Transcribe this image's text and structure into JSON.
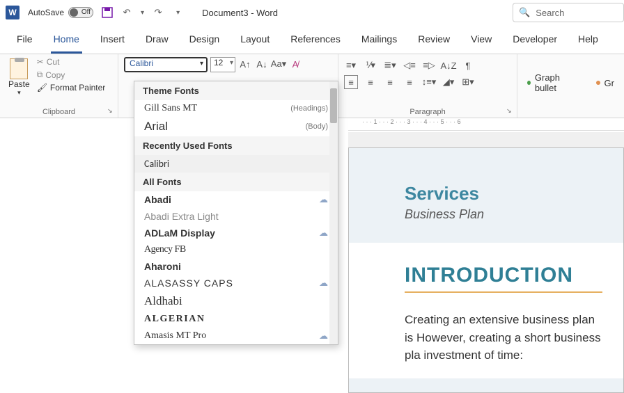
{
  "titlebar": {
    "autosave_label": "AutoSave",
    "autosave_state": "Off",
    "doc_title": "Document3 - Word",
    "search_placeholder": "Search"
  },
  "tabs": {
    "file": "File",
    "home": "Home",
    "insert": "Insert",
    "draw": "Draw",
    "design": "Design",
    "layout": "Layout",
    "references": "References",
    "mailings": "Mailings",
    "review": "Review",
    "view": "View",
    "developer": "Developer",
    "help": "Help"
  },
  "ribbon": {
    "paste": "Paste",
    "cut": "Cut",
    "copy": "Copy",
    "format_painter": "Format Painter",
    "clipboard_label": "Clipboard",
    "font_value": "Calibri",
    "size_value": "12",
    "paragraph_label": "Paragraph",
    "style_graph_bullet": "Graph bullet",
    "style_gr": "Gr"
  },
  "font_dropdown": {
    "theme_fonts": "Theme Fonts",
    "gill_sans": "Gill Sans MT",
    "headings": "(Headings)",
    "arial": "Arial",
    "body": "(Body)",
    "recently_used": "Recently Used Fonts",
    "calibri": "Calibri",
    "all_fonts": "All Fonts",
    "abadi": "Abadi",
    "abadi_extra": "Abadi Extra Light",
    "adlam": "ADLaM Display",
    "agency": "Agency FB",
    "aharoni": "Aharoni",
    "alasassy": "ALASASSY CAPS",
    "aldhabi": "Aldhabi",
    "algerian": "ALGERIAN",
    "amasis": "Amasis MT Pro"
  },
  "document": {
    "services": "Services",
    "subtitle": "Business Plan",
    "intro": "INTRODUCTION",
    "body": "Creating an extensive business plan is However, creating a short business pla investment of time:"
  },
  "ruler_ticks": [
    "1",
    "2",
    "3",
    "4",
    "5",
    "6"
  ]
}
